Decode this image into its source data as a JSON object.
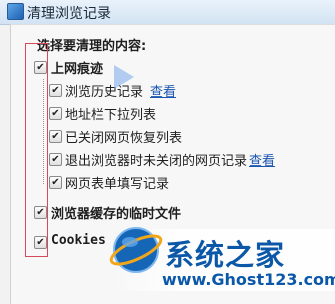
{
  "window": {
    "title": "清理浏览记录"
  },
  "section": {
    "heading": "选择要清理的内容:"
  },
  "groups": [
    {
      "label": "上网痕迹",
      "checked": true,
      "items": [
        {
          "label": "浏览历史记录",
          "checked": true,
          "link": "查看"
        },
        {
          "label": "地址栏下拉列表",
          "checked": true
        },
        {
          "label": "已关闭网页恢复列表",
          "checked": true
        },
        {
          "label": "退出浏览器时未关闭的网页记录",
          "checked": true,
          "link": "查看"
        },
        {
          "label": "网页表单填写记录",
          "checked": true
        }
      ]
    },
    {
      "label": "浏览器缓存的临时文件",
      "checked": true
    },
    {
      "label": "Cookies",
      "checked": true
    }
  ],
  "watermark": {
    "brand": "系统之家",
    "url": "www.Ghost123.com"
  },
  "icons": {
    "window": "app-icon",
    "check": "checkmark-icon",
    "logo": "globe-logo-icon"
  }
}
